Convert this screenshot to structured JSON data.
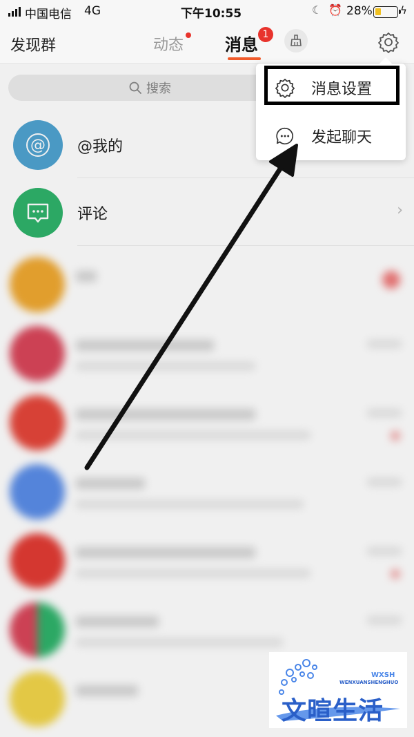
{
  "status_bar": {
    "carrier": "中国电信",
    "network": "4G",
    "time": "下午10:55",
    "battery_percent_label": "28%",
    "battery_level": 0.28
  },
  "nav": {
    "groups_label": "发现群",
    "tab_dynamic": "动态",
    "tab_messages": "消息",
    "messages_badge": "1",
    "active_tab": "消息"
  },
  "search": {
    "placeholder": "搜索"
  },
  "list": {
    "items": [
      {
        "label": "@我的",
        "icon": "at-icon",
        "color": "#4fa3d1"
      },
      {
        "label": "评论",
        "icon": "comment-icon",
        "color": "#2fb36b"
      }
    ]
  },
  "menu": {
    "items": [
      {
        "label": "消息设置",
        "icon": "gear-icon",
        "highlighted": true
      },
      {
        "label": "发起聊天",
        "icon": "chat-bubble-icon",
        "highlighted": false
      }
    ]
  },
  "watermark": {
    "logo_text": "文暄生活",
    "pinyin": "WENXUANSHENGHUO",
    "abbr": "WXSH"
  },
  "colors": {
    "accent": "#f05a2a",
    "badge": "#e8332c",
    "at_avatar": "#4fa3d1",
    "comment_avatar": "#2fb36b"
  }
}
